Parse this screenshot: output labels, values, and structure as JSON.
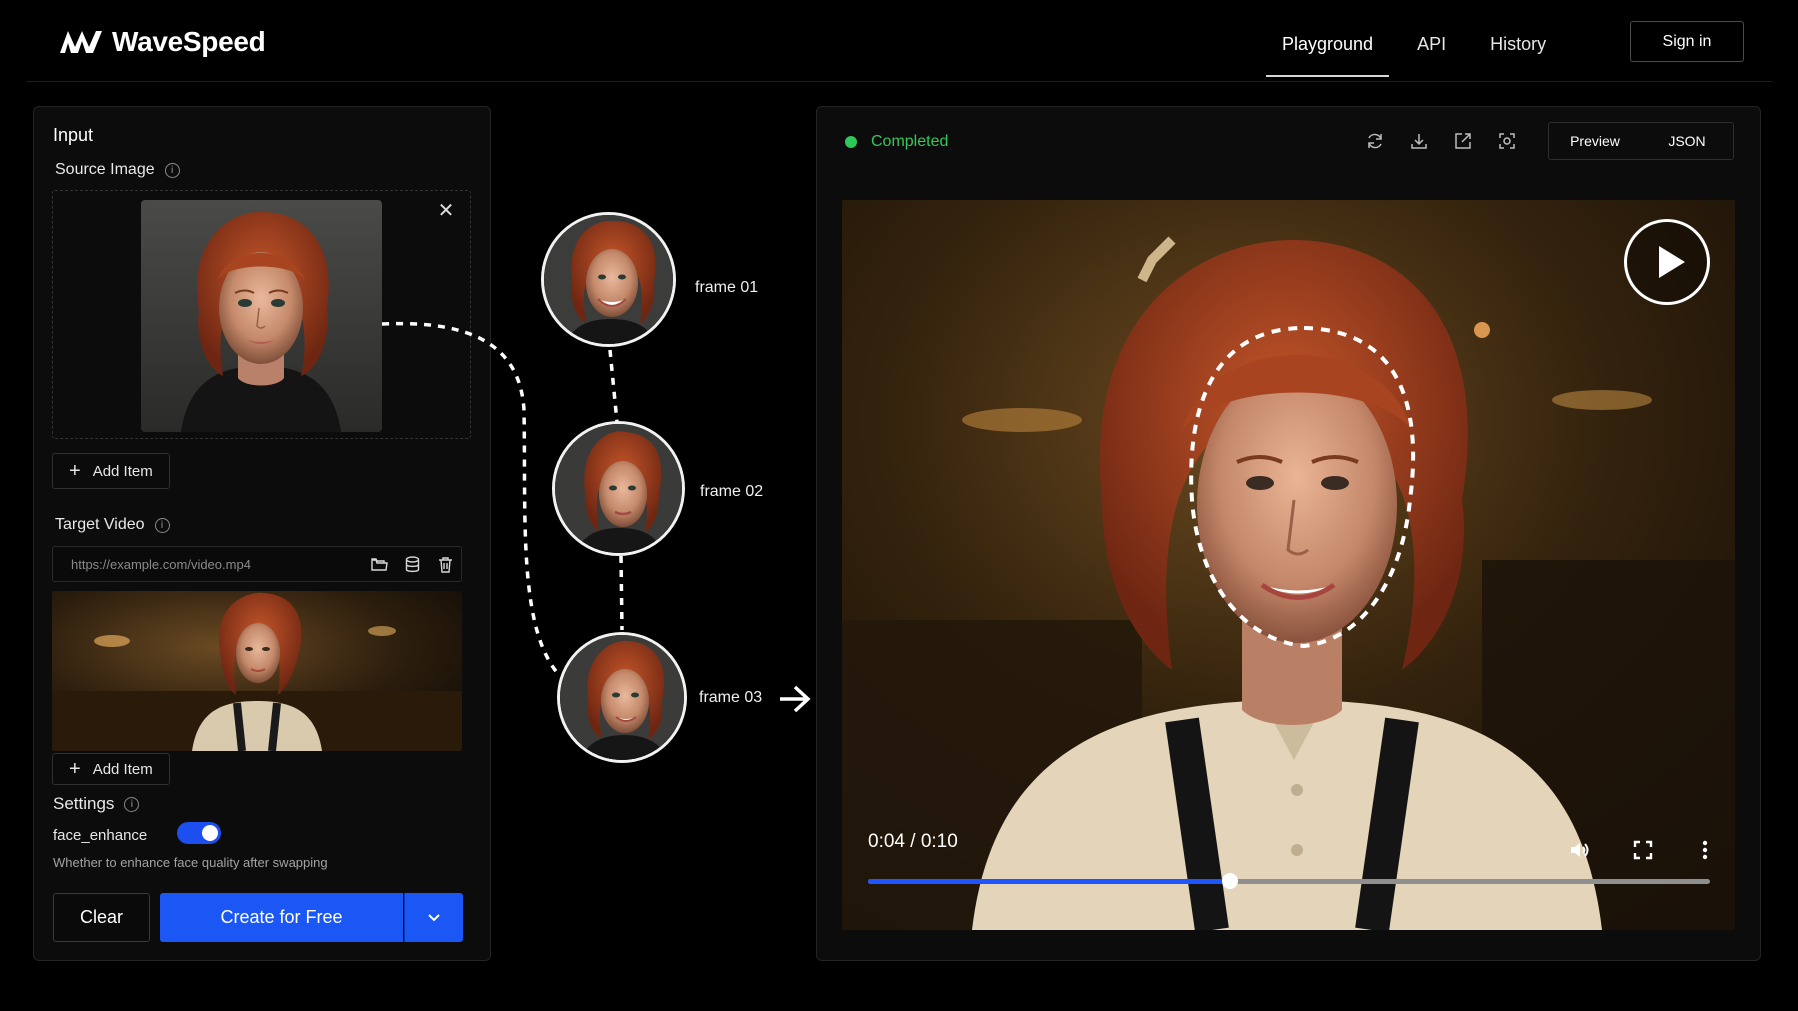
{
  "header": {
    "logo_text": "WaveSpeed",
    "nav": [
      {
        "label": "Playground",
        "active": true
      },
      {
        "label": "API",
        "active": false
      },
      {
        "label": "History",
        "active": false
      }
    ],
    "signin_label": "Sign in"
  },
  "input_panel": {
    "title": "Input",
    "source_image": {
      "label": "Source Image",
      "add_item_label": "Add Item"
    },
    "target_video": {
      "label": "Target Video",
      "url_placeholder": "https://example.com/video.mp4",
      "add_item_label": "Add Item"
    },
    "settings": {
      "label": "Settings",
      "face_enhance_label": "face_enhance",
      "face_enhance_enabled": true,
      "face_enhance_help": "Whether to enhance face quality after swapping"
    },
    "clear_label": "Clear",
    "create_label": "Create for Free"
  },
  "frames": [
    {
      "label": "frame 01"
    },
    {
      "label": "frame 02"
    },
    {
      "label": "frame 03"
    }
  ],
  "output_panel": {
    "status": "Completed",
    "status_color": "#2fc75a",
    "tools": [
      "refresh-icon",
      "download-icon",
      "open-external-icon",
      "screenshot-icon"
    ],
    "tabs": [
      "Preview",
      "JSON"
    ],
    "player": {
      "time": "0:04 / 0:10",
      "progress_fraction": 0.43
    }
  },
  "colors": {
    "accent": "#1b57f5",
    "background": "#000000",
    "panel": "#0c0c0c"
  }
}
